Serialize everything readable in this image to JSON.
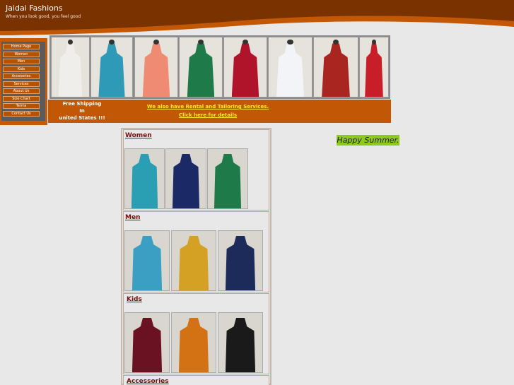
{
  "site": {
    "title": "Jaidai Fashions",
    "tagline": "When you look good, you feel good"
  },
  "colors": {
    "header_brown": "#7a3300",
    "header_swoosh": "#c25705",
    "nav_button": "#b65300",
    "promo_bg": "#c25705",
    "promo_link": "#ffea2a",
    "category_title": "#7a0d0d",
    "happy_bg": "#8ec91e"
  },
  "nav": {
    "items": [
      {
        "label": "Home Page"
      },
      {
        "label": "Women"
      },
      {
        "label": "Men"
      },
      {
        "label": "Kids"
      },
      {
        "label": "Accesories"
      },
      {
        "label": "Services"
      },
      {
        "label": "About Us"
      },
      {
        "label": "Size Chart"
      },
      {
        "label": "Terms"
      },
      {
        "label": "Contact Us"
      }
    ]
  },
  "banner": {
    "photos": [
      {
        "color": "#efeeea"
      },
      {
        "color": "#2f9ab8"
      },
      {
        "color": "#ef8b72"
      },
      {
        "color": "#1f7a4a"
      },
      {
        "color": "#b0142b"
      },
      {
        "color": "#f3f4f7"
      },
      {
        "color": "#a8261f"
      },
      {
        "color": "#c81e2a"
      }
    ]
  },
  "promo": {
    "free_shipping_line1": "Free Shipping",
    "free_shipping_line2": "In",
    "free_shipping_line3": "united States !!!",
    "rental_text": "We also have Rental and Tailoring Services.",
    "details_link": "Click here for details"
  },
  "categories": [
    {
      "title": "Women",
      "thumbs": [
        {
          "color": "#2a9fb3"
        },
        {
          "color": "#1b2a66"
        },
        {
          "color": "#1f7a4a"
        }
      ]
    },
    {
      "title": "Men",
      "thumbs": [
        {
          "color": "#3a9fc2"
        },
        {
          "color": "#d4a124"
        },
        {
          "color": "#1c2b5a"
        }
      ]
    },
    {
      "title": "Kids",
      "thumbs": [
        {
          "color": "#6a1222"
        },
        {
          "color": "#d27214"
        },
        {
          "color": "#1a1a1a"
        }
      ]
    },
    {
      "title": "Accessories",
      "thumbs": []
    }
  ],
  "happy_summer": "Happy Summer."
}
